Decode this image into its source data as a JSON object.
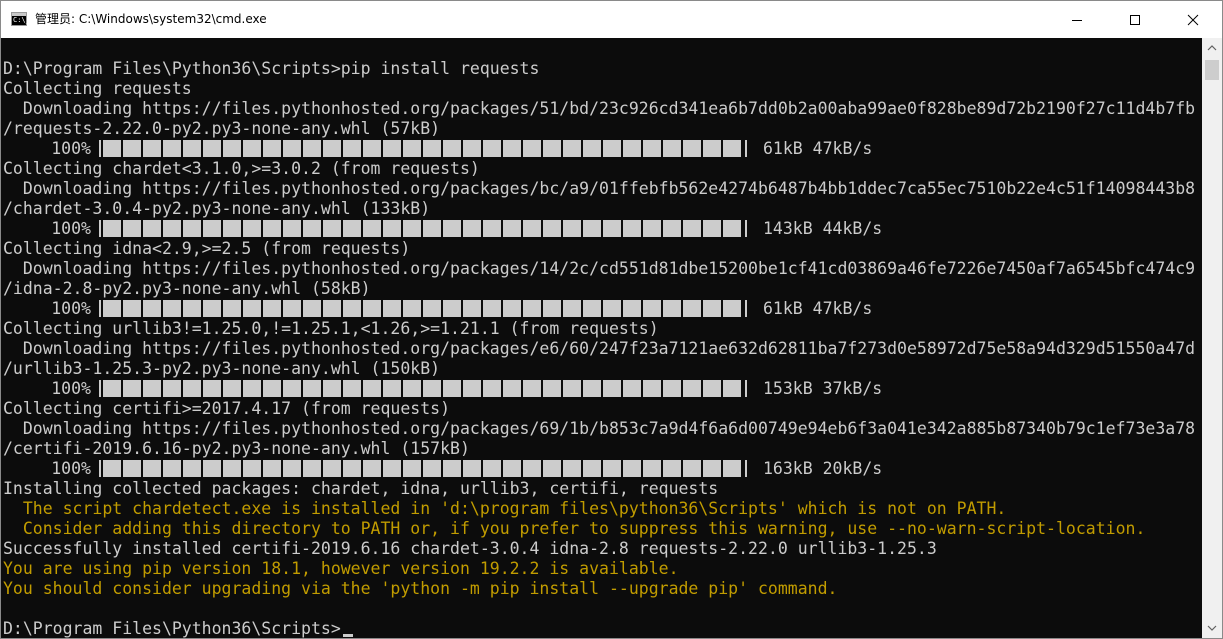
{
  "window": {
    "title": "管理员: C:\\Windows\\system32\\cmd.exe",
    "icon": "cmd-icon",
    "icon_glyph": "C:\\_"
  },
  "controls": {
    "minimize": "minimize-icon",
    "maximize": "maximize-icon",
    "close": "close-icon"
  },
  "colors": {
    "background": "#0c0c0c",
    "text": "#cccccc",
    "warning": "#c19c00"
  },
  "console": {
    "lines": [
      "D:\\Program Files\\Python36\\Scripts>pip install requests",
      "Collecting requests",
      "  Downloading https://files.pythonhosted.org/packages/51/bd/23c926cd341ea6b7dd0b2a00aba99ae0f828be89d72b2190f27c11d4b7fb",
      "/requests-2.22.0-py2.py3-none-any.whl (57kB)",
      "Collecting chardet<3.1.0,>=3.0.2 (from requests)",
      "  Downloading https://files.pythonhosted.org/packages/bc/a9/01ffebfb562e4274b6487b4bb1ddec7ca55ec7510b22e4c51f14098443b8",
      "/chardet-3.0.4-py2.py3-none-any.whl (133kB)",
      "Collecting idna<2.9,>=2.5 (from requests)",
      "  Downloading https://files.pythonhosted.org/packages/14/2c/cd551d81dbe15200be1cf41cd03869a46fe7226e7450af7a6545bfc474c9",
      "/idna-2.8-py2.py3-none-any.whl (58kB)",
      "Collecting urllib3!=1.25.0,!=1.25.1,<1.26,>=1.21.1 (from requests)",
      "  Downloading https://files.pythonhosted.org/packages/e6/60/247f23a7121ae632d62811ba7f273d0e58972d75e58a94d329d51550a47d",
      "/urllib3-1.25.3-py2.py3-none-any.whl (150kB)",
      "Collecting certifi>=2017.4.17 (from requests)",
      "  Downloading https://files.pythonhosted.org/packages/69/1b/b853c7a9d4f6a6d00749e94eb6f3a041e342a885b87340b79c1ef73e3a78",
      "/certifi-2019.6.16-py2.py3-none-any.whl (157kB)",
      "Installing collected packages: chardet, idna, urllib3, certifi, requests",
      "  The script chardetect.exe is installed in 'd:\\program files\\python36\\Scripts' which is not on PATH.",
      "  Consider adding this directory to PATH or, if you prefer to suppress this warning, use --no-warn-script-location.",
      "Successfully installed certifi-2019.6.16 chardet-3.0.4 idna-2.8 requests-2.22.0 urllib3-1.25.3",
      "You are using pip version 18.1, however version 19.2.2 is available.",
      "You should consider upgrading via the 'python -m pip install --upgrade pip' command.",
      "",
      "D:\\Program Files\\Python36\\Scripts>"
    ],
    "progress": [
      {
        "percent_label": "100%",
        "fraction": 1.0,
        "stats": "61kB 47kB/s"
      },
      {
        "percent_label": "100%",
        "fraction": 1.0,
        "stats": "143kB 44kB/s"
      },
      {
        "percent_label": "100%",
        "fraction": 1.0,
        "stats": "61kB 47kB/s"
      },
      {
        "percent_label": "100%",
        "fraction": 1.0,
        "stats": "153kB 37kB/s"
      },
      {
        "percent_label": "100%",
        "fraction": 1.0,
        "stats": "163kB 20kB/s"
      }
    ]
  },
  "scrollbar": {
    "up": "scroll-up-arrow-icon",
    "down": "scroll-down-arrow-icon"
  }
}
